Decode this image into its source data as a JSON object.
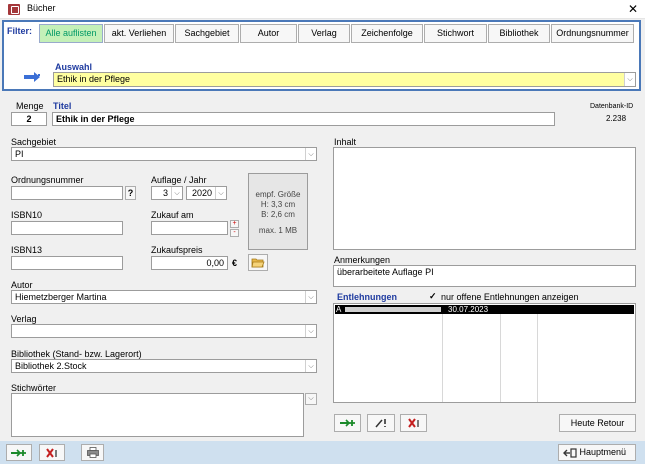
{
  "window": {
    "title": "Bücher"
  },
  "filter": {
    "label": "Filter:",
    "buttons": [
      "Alle auflisten",
      "akt. Verliehen",
      "Sachgebiet",
      "Autor",
      "Verlag",
      "Zeichenfolge",
      "Stichwort",
      "Bibliothek",
      "Ordnungsnummer"
    ],
    "active_index": 0,
    "auswahl_label": "Auswahl",
    "auswahl_value": "Ethik in der Pflege"
  },
  "book": {
    "menge_label": "Menge",
    "menge_value": "2",
    "titel_label": "Titel",
    "titel_value": "Ethik in der Pflege",
    "datenbank_id_label": "Datenbank-ID",
    "datenbank_id_value": "2.238",
    "sachgebiet_label": "Sachgebiet",
    "sachgebiet_value": "PI",
    "ordnungsnummer_label": "Ordnungsnummer",
    "ordnungsnummer_value": "",
    "ordnungsnummer_btn": "?",
    "auflage_label": "Auflage / Jahr",
    "auflage_value": "3",
    "jahr_value": "2020",
    "isbn10_label": "ISBN10",
    "isbn10_value": "",
    "zukauf_label": "Zukauf am",
    "zukauf_value": "",
    "zukauf_plus": "+",
    "zukauf_minus": "-",
    "isbn13_label": "ISBN13",
    "isbn13_value": "",
    "zukaufspreis_label": "Zukaufspreis",
    "zukaufspreis_value": "0,00",
    "currency": "€",
    "image_hint": [
      "empf. Größe",
      "H: 3,3 cm",
      "B: 2,6 cm",
      "",
      "max. 1 MB"
    ],
    "autor_label": "Autor",
    "autor_value": "Hiemetzberger Martina",
    "verlag_label": "Verlag",
    "verlag_value": "",
    "bibliothek_label": "Bibliothek (Stand- bzw. Lagerort)",
    "bibliothek_value": "Bibliothek 2.Stock",
    "stichwoerter_label": "Stichwörter",
    "inhalt_label": "Inhalt",
    "anmerkungen_label": "Anmerkungen",
    "anmerkungen_value": "überarbeitete Auflage PI"
  },
  "entlehnungen": {
    "label": "Entlehnungen",
    "checkbox_label": "nur offene Entlehnungen anzeigen",
    "checkbox_checked": true,
    "rows": [
      {
        "col1": "A",
        "date": "30.07.2023"
      }
    ],
    "heute_retour_label": "Heute Retour"
  },
  "footer": {
    "hauptmenu_label": "Hauptmenü"
  },
  "colors": {
    "accent": "#1f3ba0",
    "frame": "#4a78b8",
    "highlight": "#ffffa0",
    "active_filter": "#c4f0b8"
  }
}
